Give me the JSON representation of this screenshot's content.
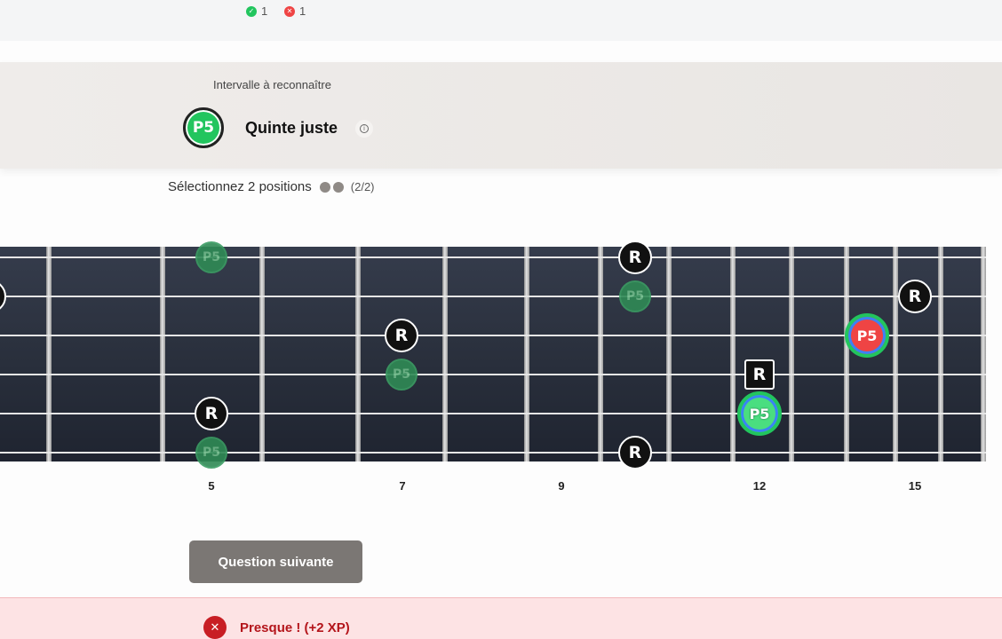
{
  "score": {
    "correct": "1",
    "incorrect": "1",
    "correct_icon": "check-circle-icon",
    "incorrect_icon": "x-circle-icon"
  },
  "interval": {
    "label": "Intervalle à reconnaître",
    "badge": "P5",
    "name": "Quinte juste",
    "info_icon": "info-icon"
  },
  "instruction": {
    "text": "Sélectionnez 2 positions",
    "count": "(2/2)"
  },
  "fretboard": {
    "root_label": "R",
    "interval_label": "P5",
    "fret_numbers": [
      "5",
      "7",
      "9",
      "12",
      "15"
    ]
  },
  "next_button": "Question suivante",
  "feedback": {
    "message": "Presque ! (+2 XP)",
    "icon": "x-icon"
  },
  "colors": {
    "correct": "#22c55e",
    "wrong": "#ef4444",
    "root": "#111111",
    "board": "#2a303d",
    "feedback_bg": "#fde3e4"
  }
}
